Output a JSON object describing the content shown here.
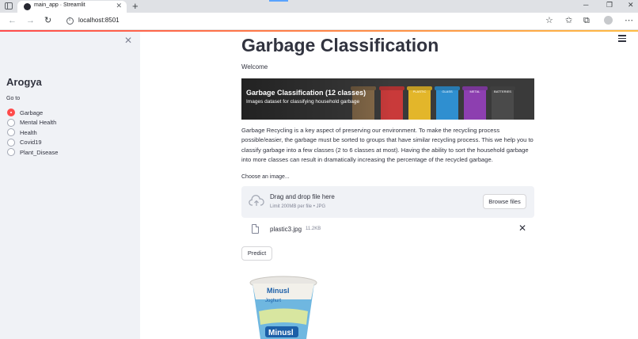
{
  "browser": {
    "tab_title": "main_app · Streamlit",
    "url": "localhost:8501"
  },
  "sidebar": {
    "title": "Arogya",
    "nav_label": "Go to",
    "options": [
      {
        "label": "Garbage",
        "selected": true
      },
      {
        "label": "Mental Health",
        "selected": false
      },
      {
        "label": "Health",
        "selected": false
      },
      {
        "label": "Covid19",
        "selected": false
      },
      {
        "label": "Plant_Disease",
        "selected": false
      }
    ]
  },
  "main": {
    "title": "Garbage Classification",
    "welcome": "Welcome",
    "banner": {
      "title": "Garbage Classification (12 classes)",
      "subtitle": "Images dataset for classifying household garbage",
      "bin_labels": [
        "PLASTIC",
        "GLASS",
        "METAL",
        "BATTERIES"
      ]
    },
    "description": "Garbage Recycling is a key aspect of preserving our environment. To make the recycling process possible/easier, the garbage must be sorted to groups that have similar recycling process. This we help you to classify garbage into a few classes (2 to 6 classes at most). Having the ability to sort the household garbage into more classes can result in dramatically increasing the percentage of the recycled garbage.",
    "uploader": {
      "label": "Choose an image...",
      "drop_text": "Drag and drop file here",
      "limit_text": "Limit 200MB per file • JPG",
      "browse_label": "Browse files"
    },
    "uploaded_file": {
      "name": "plastic3.jpg",
      "size": "11.2KB"
    },
    "predict_label": "Predict",
    "image_text": {
      "brand": "Minusl",
      "product": "Joghurt"
    }
  },
  "colors": {
    "accent": "#ff4b4b",
    "sidebar_bg": "#f0f2f6",
    "text": "#31333f"
  }
}
